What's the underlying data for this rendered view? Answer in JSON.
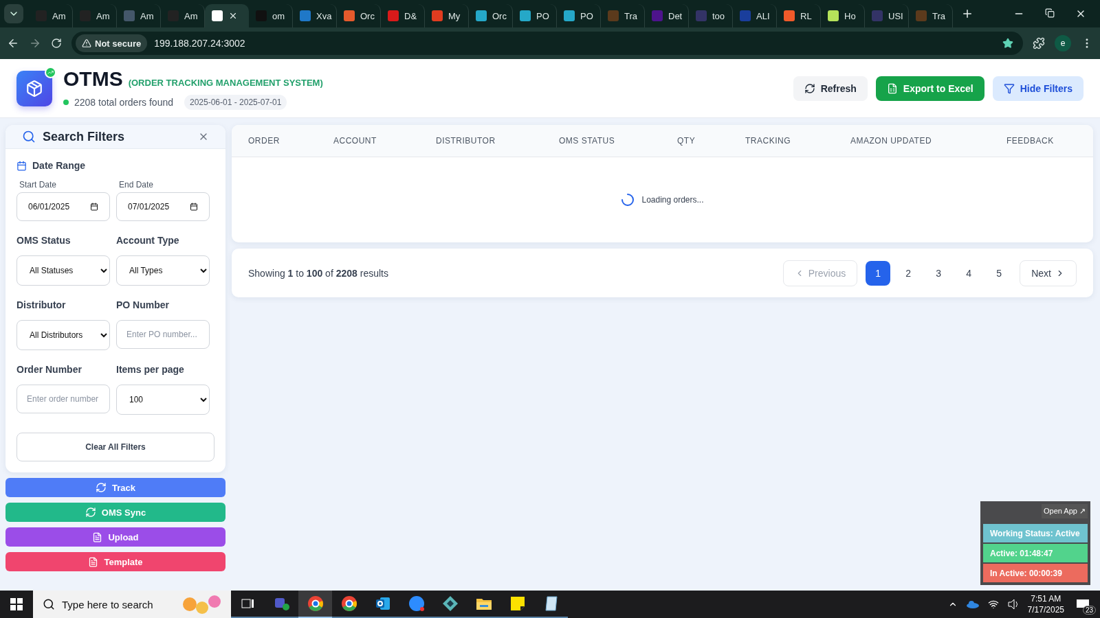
{
  "browser": {
    "tabs": [
      {
        "title": "Am",
        "selected": false,
        "kind": "amazon"
      },
      {
        "title": "Am",
        "selected": false,
        "kind": "amazon"
      },
      {
        "title": "Am",
        "selected": false,
        "kind": "amazon-grey"
      },
      {
        "title": "Am",
        "selected": false,
        "kind": "amazon"
      },
      {
        "selected": true,
        "kind": "app"
      },
      {
        "title": "om",
        "selected": false,
        "kind": "black"
      },
      {
        "title": "Xva",
        "selected": false,
        "kind": "blue"
      },
      {
        "title": "Orc",
        "selected": false,
        "kind": "orange"
      },
      {
        "title": "D&",
        "selected": false,
        "kind": "red"
      },
      {
        "title": "My",
        "selected": false,
        "kind": "red-ring"
      },
      {
        "title": "Orc",
        "selected": false,
        "kind": "ec"
      },
      {
        "title": "PO",
        "selected": false,
        "kind": "ec"
      },
      {
        "title": "PO",
        "selected": false,
        "kind": "ec"
      },
      {
        "title": "Tra",
        "selected": false,
        "kind": "ups"
      },
      {
        "title": "Det",
        "selected": false,
        "kind": "fedex"
      },
      {
        "title": "too",
        "selected": false,
        "kind": "usps"
      },
      {
        "title": "ALI",
        "selected": false,
        "kind": "navy"
      },
      {
        "title": "RL",
        "selected": false,
        "kind": "orange-circle"
      },
      {
        "title": "Ho",
        "selected": false,
        "kind": "lime"
      },
      {
        "title": "USI",
        "selected": false,
        "kind": "usps"
      },
      {
        "title": "Tra",
        "selected": false,
        "kind": "ups"
      }
    ],
    "security": "Not secure",
    "url": "199.188.207.24:3002",
    "profile": "e"
  },
  "header": {
    "title": "OTMS",
    "subtitle": "(ORDER TRACKING MANAGEMENT SYSTEM)",
    "count": "2208 total orders found",
    "date_range": "2025-06-01 - 2025-07-01",
    "actions": [
      {
        "label": "Refresh",
        "kind": "refresh"
      },
      {
        "label": "Export to Excel",
        "kind": "export"
      },
      {
        "label": "Hide Filters",
        "kind": "filter"
      }
    ]
  },
  "filters": {
    "title": "Search Filters",
    "date_label": "Date Range",
    "dates": [
      {
        "label": "Start Date",
        "value": "06/01/2025"
      },
      {
        "label": "End Date",
        "value": "07/01/2025"
      }
    ],
    "fields": [
      {
        "label": "OMS Status",
        "kind": "select",
        "value": "All Statuses"
      },
      {
        "label": "Account Type",
        "kind": "select",
        "value": "All Types"
      },
      {
        "label": "Distributor",
        "kind": "select",
        "value": "All Distributors"
      },
      {
        "label": "PO Number",
        "kind": "input",
        "placeholder": "Enter PO number..."
      },
      {
        "label": "Order Number",
        "kind": "input",
        "placeholder": "Enter order number"
      },
      {
        "label": "Items per page",
        "kind": "select",
        "value": "100"
      }
    ],
    "clear": "Clear All Filters"
  },
  "side_actions": [
    {
      "label": "Track",
      "kind": "sync",
      "color": "#4f7cf7"
    },
    {
      "label": "OMS Sync",
      "kind": "sync",
      "color": "#22b98a"
    },
    {
      "label": "Upload",
      "kind": "file",
      "color": "#9b4de8"
    },
    {
      "label": "Template",
      "kind": "file",
      "color": "#f0456e"
    }
  ],
  "table": {
    "columns": [
      "ORDER",
      "ACCOUNT",
      "DISTRIBUTOR",
      "OMS STATUS",
      "QTY",
      "TRACKING",
      "AMAZON UPDATED",
      "FEEDBACK"
    ],
    "loading": "Loading orders..."
  },
  "pagination": {
    "summary": "Showing **1** to **100** of **2208** results",
    "previous": {
      "label": "Previous",
      "disabled": true
    },
    "pages": [
      {
        "label": "1",
        "selected": true
      },
      {
        "label": "2",
        "selected": false
      },
      {
        "label": "3",
        "selected": false
      },
      {
        "label": "4",
        "selected": false
      },
      {
        "label": "5",
        "selected": false
      }
    ],
    "next": {
      "label": "Next",
      "disabled": false
    }
  },
  "widget": {
    "open": "Open App ↗",
    "rows": [
      {
        "text": "Working Status: Active",
        "color": "#6fc3cf"
      },
      {
        "text": "Active: 01:48:47",
        "color": "#52d38c"
      },
      {
        "text": "In Active: 00:00:39",
        "color": "#ec6b5e"
      }
    ]
  },
  "taskbar": {
    "search": {
      "placeholder": "Type here to search"
    },
    "apps": [
      {
        "kind": "tasks",
        "selected": false
      },
      {
        "kind": "teams",
        "selected": false
      },
      {
        "kind": "chrome",
        "selected": true
      },
      {
        "kind": "chrome",
        "selected": false
      },
      {
        "kind": "outlook",
        "selected": false
      },
      {
        "kind": "zoom",
        "selected": false
      },
      {
        "kind": "diamond",
        "selected": false
      },
      {
        "kind": "folder",
        "selected": false
      },
      {
        "kind": "notes",
        "selected": false
      },
      {
        "kind": "notepad",
        "selected": false
      }
    ],
    "time": "7:51 AM",
    "date": "7/17/2025",
    "notifications": "23"
  }
}
